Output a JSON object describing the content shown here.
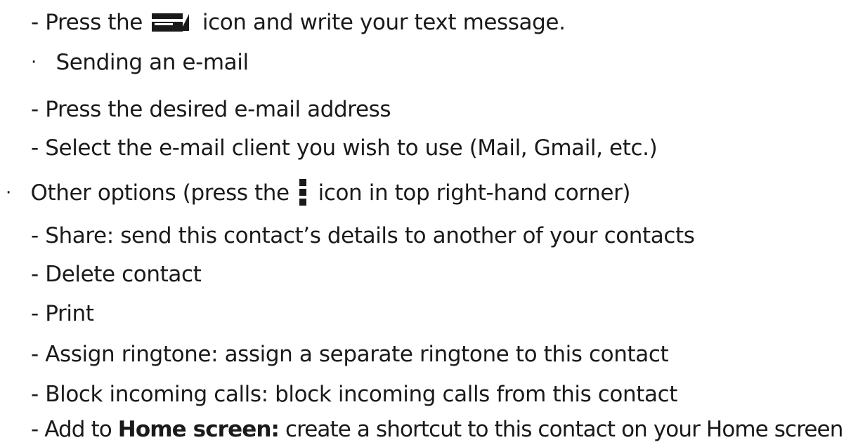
{
  "lines": [
    {
      "prefix": "- ",
      "before_icon": "Press the ",
      "icon": "compose-message-icon",
      "after_icon": " icon and write your text message."
    },
    {
      "bullet": "·",
      "text": " Sending an e-mail"
    },
    {
      "prefix": "- ",
      "text": "Press the desired e-mail address"
    },
    {
      "prefix": "- ",
      "text": "Select the e-mail client you wish to use (Mail, Gmail, etc.)"
    },
    {
      "bullet": "·",
      "before_icon": " Other options (press the ",
      "icon": "overflow-menu-icon",
      "after_icon": " icon in top right-hand corner)"
    },
    {
      "prefix": "- ",
      "text": "Share: send this contact’s details to another of your contacts"
    },
    {
      "prefix": "- ",
      "text": "Delete contact"
    },
    {
      "prefix": "- ",
      "text": "Print"
    },
    {
      "prefix": "- ",
      "text": "Assign ringtone: assign a separate ringtone to this contact"
    },
    {
      "prefix": "- ",
      "text": "Block incoming calls: block incoming calls from this contact"
    },
    {
      "prefix": "- ",
      "before_bold": "Add to ",
      "bold": "Home screen:",
      "after_bold": " create a shortcut to this contact on your Home screen"
    }
  ]
}
